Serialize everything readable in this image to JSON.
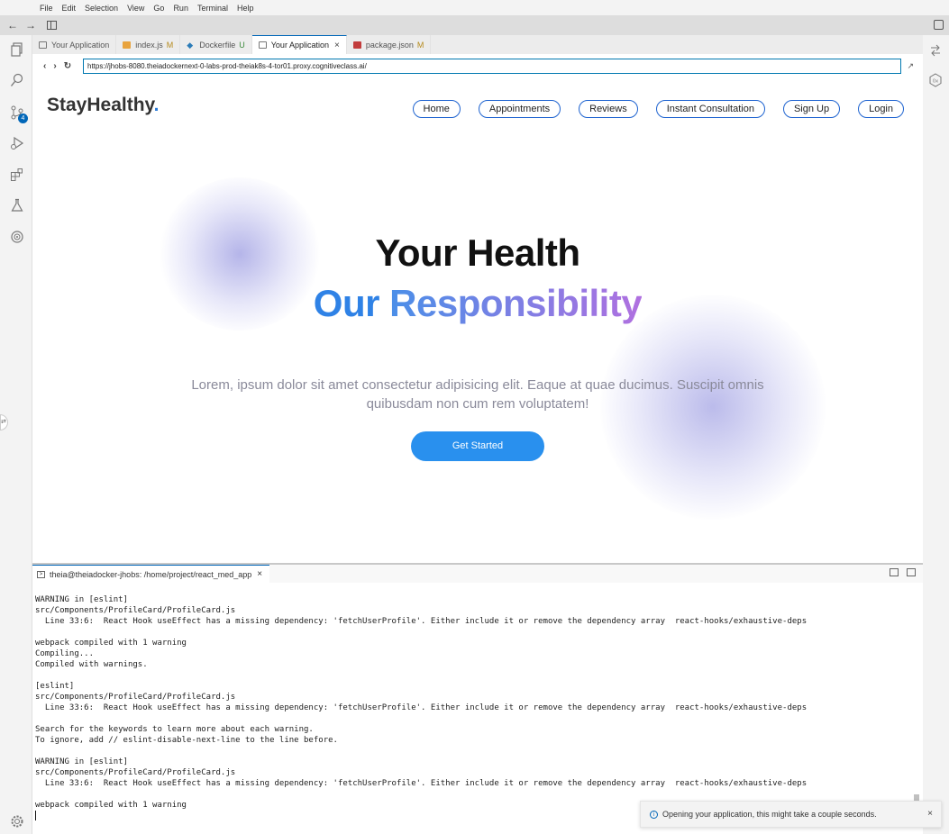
{
  "menu": [
    "File",
    "Edit",
    "Selection",
    "View",
    "Go",
    "Run",
    "Terminal",
    "Help"
  ],
  "nav_arrows": {
    "back": "←",
    "forward": "→"
  },
  "activity": {
    "scm_badge": "4"
  },
  "tabs": [
    {
      "label": "Your Application",
      "icon": "preview-icon",
      "marker": "",
      "active": false
    },
    {
      "label": "index.js",
      "icon": "js-file-icon",
      "marker": "M",
      "active": false
    },
    {
      "label": "Dockerfile",
      "icon": "docker-icon",
      "marker": "U",
      "active": false
    },
    {
      "label": "Your Application",
      "icon": "preview-icon",
      "marker": "",
      "active": true,
      "close": "×"
    },
    {
      "label": "package.json",
      "icon": "json-file-icon",
      "marker": "M",
      "active": false
    }
  ],
  "browser": {
    "back": "‹",
    "forward": "›",
    "reload": "↻",
    "external": "↗",
    "url": "https://jhobs-8080.theiadockernext-0-labs-prod-theiak8s-4-tor01.proxy.cognitiveclass.ai/"
  },
  "site": {
    "logo_text": "StayHealthy",
    "logo_dot": ".",
    "nav": [
      "Home",
      "Appointments",
      "Reviews",
      "Instant Consultation",
      "Sign Up",
      "Login"
    ],
    "headline1": "Your Health",
    "headline2_a": "Our",
    "headline2_b": "Responsibility",
    "lorem": "Lorem, ipsum dolor sit amet consectetur adipisicing elit. Eaque at quae ducimus. Suscipit omnis quibusdam non cum rem voluptatem!",
    "cta": "Get Started",
    "colors": {
      "brand_blue": "#2990ee",
      "gradient_end": "#b070e0"
    }
  },
  "terminal": {
    "tab_label": "theia@theiadocker-jhobs: /home/project/react_med_app",
    "close": "×",
    "output": "WARNING in [eslint]\nsrc/Components/ProfileCard/ProfileCard.js\n  Line 33:6:  React Hook useEffect has a missing dependency: 'fetchUserProfile'. Either include it or remove the dependency array  react-hooks/exhaustive-deps\n\nwebpack compiled with 1 warning\nCompiling...\nCompiled with warnings.\n\n[eslint]\nsrc/Components/ProfileCard/ProfileCard.js\n  Line 33:6:  React Hook useEffect has a missing dependency: 'fetchUserProfile'. Either include it or remove the dependency array  react-hooks/exhaustive-deps\n\nSearch for the keywords to learn more about each warning.\nTo ignore, add // eslint-disable-next-line to the line before.\n\nWARNING in [eslint]\nsrc/Components/ProfileCard/ProfileCard.js\n  Line 33:6:  React Hook useEffect has a missing dependency: 'fetchUserProfile'. Either include it or remove the dependency array  react-hooks/exhaustive-deps\n\nwebpack compiled with 1 warning\n"
  },
  "toast": {
    "message": "Opening your application, this might take a couple seconds.",
    "close": "×",
    "info": "i"
  }
}
